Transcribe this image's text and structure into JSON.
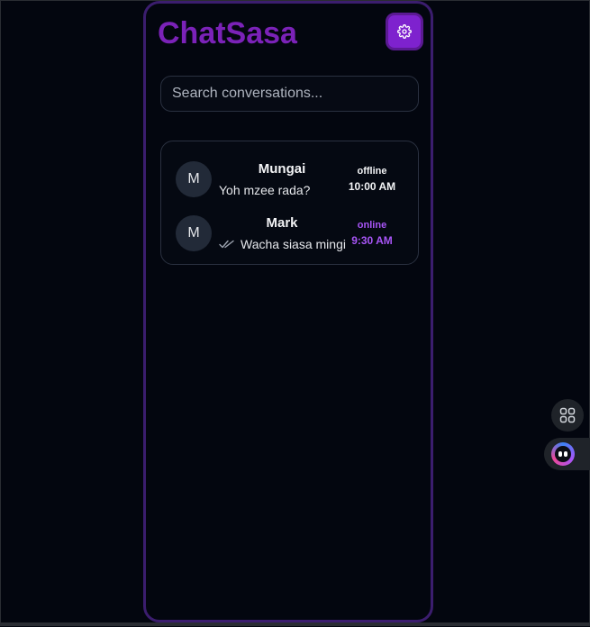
{
  "app": {
    "title": "ChatSasa",
    "brand_color": "#7b22b8",
    "accent_color": "#7e22ce"
  },
  "header": {
    "settings_icon": "gear-icon"
  },
  "search": {
    "placeholder": "Search conversations...",
    "value": ""
  },
  "chats": [
    {
      "avatar_initial": "M",
      "name": "Mungai",
      "preview": "Yoh mzee rada?",
      "status": "offline",
      "time": "10:00 AM",
      "status_color": "#f3f4f6",
      "read_receipt": false
    },
    {
      "avatar_initial": "M",
      "name": "Mark",
      "preview": "Wacha siasa mingi",
      "status": "online",
      "time": "9:30 AM",
      "status_color": "#a855f7",
      "read_receipt": true
    }
  ],
  "floating": {
    "apps_icon": "grid-icon",
    "assistant_icon": "bot-icon"
  }
}
